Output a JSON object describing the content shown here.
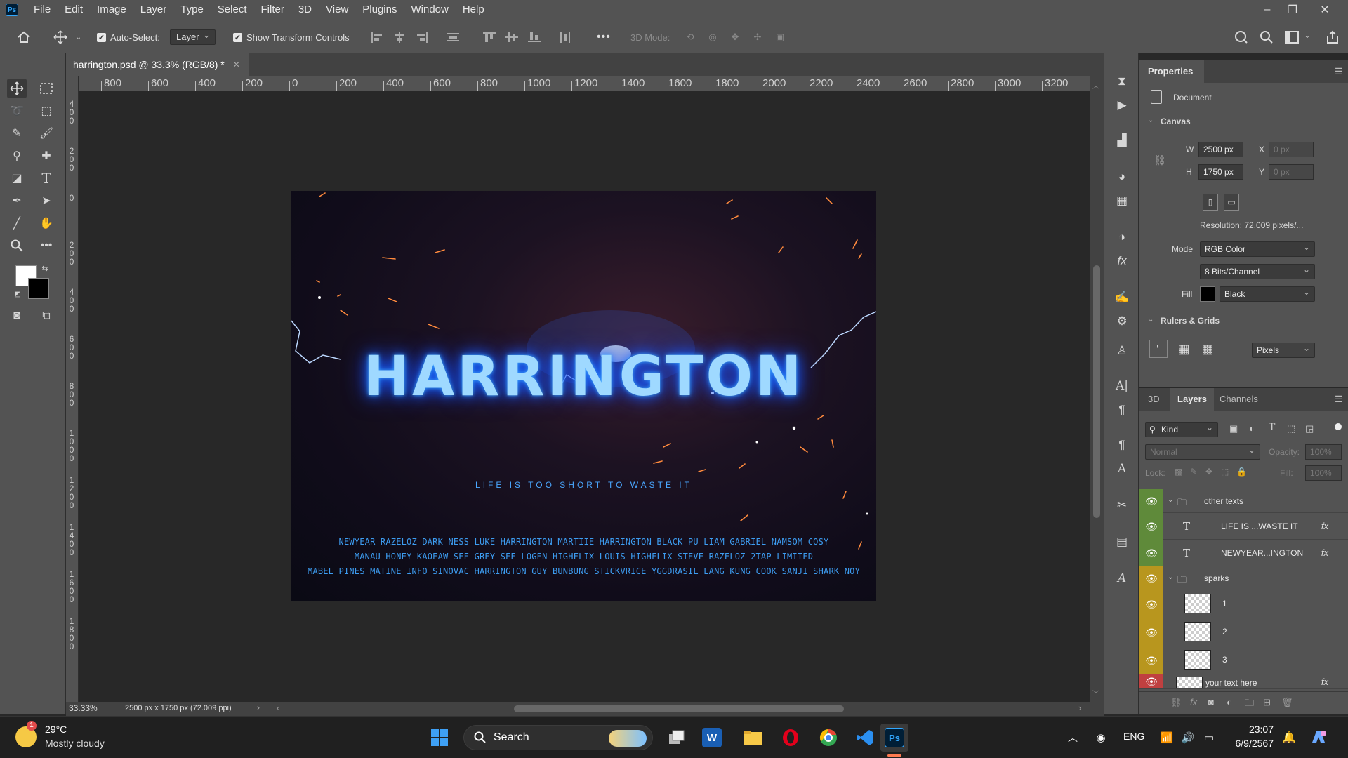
{
  "app": {
    "logo": "Ps",
    "menus": [
      "File",
      "Edit",
      "Image",
      "Layer",
      "Type",
      "Select",
      "Filter",
      "3D",
      "View",
      "Plugins",
      "Window",
      "Help"
    ]
  },
  "options": {
    "auto_select_label": "Auto-Select:",
    "auto_select_checked": true,
    "target": "Layer",
    "show_transform_label": "Show Transform Controls",
    "more": "•••",
    "mode3d_label": "3D Mode:"
  },
  "document": {
    "tab_title": "harrington.psd @ 33.3% (RGB/8) *",
    "zoom": "33.33%",
    "info": "2500 px x 1750 px (72.009 ppi)"
  },
  "ruler": {
    "top": [
      "800",
      "600",
      "400",
      "200",
      "0",
      "200",
      "400",
      "600",
      "800",
      "1000",
      "1200",
      "1400",
      "1600",
      "1800",
      "2000",
      "2200",
      "2400",
      "2600",
      "2800",
      "3000",
      "3200"
    ],
    "left": [
      "400",
      "200",
      "0",
      "200",
      "400",
      "600",
      "800",
      "1000",
      "1200",
      "1400",
      "1600",
      "1800"
    ]
  },
  "artwork": {
    "title": "HARRINGTON",
    "tagline": "LIFE IS TOO SHORT TO WASTE IT",
    "credits": [
      "NEWYEAR RAZELOZ  DARK NESS  LUKE HARRINGTON  MARTIIE HARRINGTON  BLACK PU  LIAM GABRIEL  NAMSOM COSY",
      "MANAU HONEY  KAOEAW SEE  GREY SEE  LOGEN HIGHFLIX  LOUIS HIGHFLIX  STEVE RAZELOZ  2TAP LIMITED",
      "MABEL PINES  MATINE INFO  SINOVAC HARRINGTON  GUY BUNBUNG  STICKVRICE YGGDRASIL  LANG KUNG  COOK SANJI  SHARK NOY"
    ]
  },
  "properties": {
    "tab": "Properties",
    "doc_label": "Document",
    "canvas_section": "Canvas",
    "w_label": "W",
    "w": "2500 px",
    "h_label": "H",
    "h": "1750 px",
    "x_label": "X",
    "x": "0 px",
    "y_label": "Y",
    "y": "0 px",
    "resolution": "Resolution: 72.009 pixels/...",
    "mode_label": "Mode",
    "mode": "RGB Color",
    "depth": "8 Bits/Channel",
    "fill_label": "Fill",
    "fill": "Black",
    "rulers_section": "Rulers & Grids",
    "units": "Pixels"
  },
  "layers_panel": {
    "tabs": [
      "3D",
      "Layers",
      "Channels"
    ],
    "active_tab": "Layers",
    "filter": "Kind",
    "blend": "Normal",
    "opacity_label": "Opacity:",
    "opacity": "100%",
    "lock_label": "Lock:",
    "fill_label": "Fill:",
    "fill": "100%",
    "rows": [
      {
        "name": "other texts",
        "type": "group",
        "color": "#5f8a3a"
      },
      {
        "name": "LIFE IS ...WASTE IT",
        "type": "text",
        "color": "#5f8a3a",
        "fx": "fx"
      },
      {
        "name": "NEWYEAR...INGTON",
        "type": "text",
        "color": "#5f8a3a",
        "fx": "fx"
      },
      {
        "name": "sparks",
        "type": "group",
        "color": "#b8961e"
      },
      {
        "name": "1",
        "type": "pixel",
        "color": "#b8961e"
      },
      {
        "name": "2",
        "type": "pixel",
        "color": "#b8961e"
      },
      {
        "name": "3",
        "type": "pixel",
        "color": "#b8961e"
      },
      {
        "name": "your text here",
        "type": "smart",
        "color": "#c04040",
        "fx": "fx"
      }
    ]
  },
  "taskbar": {
    "weather_temp": "29°C",
    "weather_desc": "Mostly cloudy",
    "weather_badge": "1",
    "search": "Search",
    "lang": "ENG",
    "time": "23:07",
    "date": "6/9/2567"
  },
  "colors": {
    "accent": "#31a8ff",
    "green_label": "#5f8a3a",
    "yellow_label": "#b8961e",
    "red_label": "#c04040"
  }
}
